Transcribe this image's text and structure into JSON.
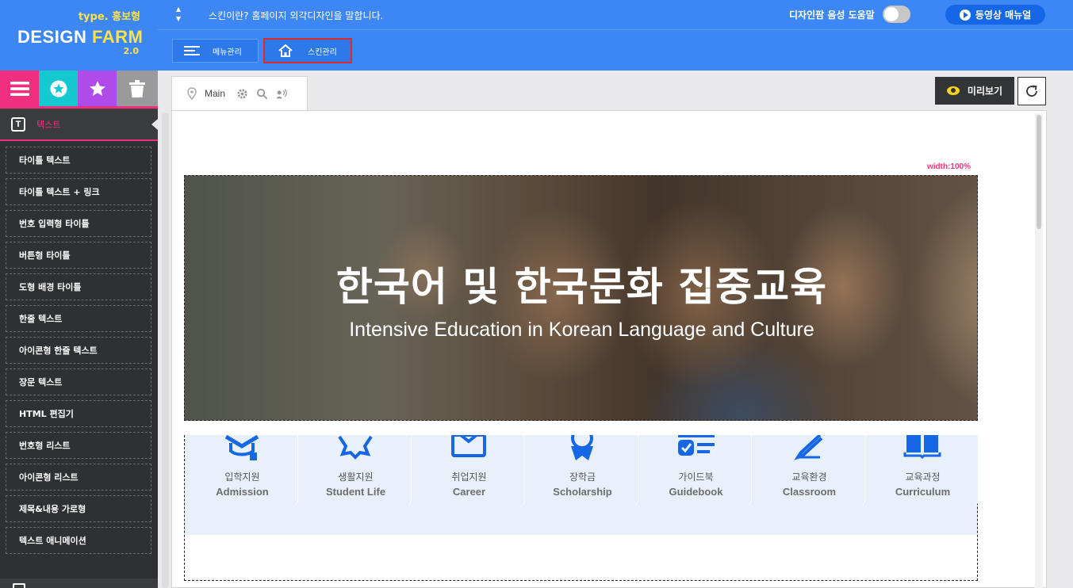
{
  "logo": {
    "type": "type. 홍보형",
    "design": "DESIGN",
    "farm": "FARM",
    "version": "2.0"
  },
  "topbar": {
    "description": "스킨이란? 홈페이지 외각디자인을 말합니다.",
    "voice_help_label": "디자인팜 음성 도움말",
    "voice_help_on": false,
    "video_manual_label": "동영상 매뉴얼"
  },
  "subbar": {
    "menu_label": "메뉴관리",
    "skin_label": "스킨관리"
  },
  "sidebar": {
    "category_icons": [
      "menu-icon",
      "star-circle-icon",
      "star-icon",
      "trash-icon"
    ],
    "category_colors": [
      "#f0307f",
      "#16c8d0",
      "#b04ae8",
      "#9a9a9c"
    ],
    "section_icon_letter": "T",
    "section_title": "텍스트",
    "items": [
      "타이틀 텍스트",
      "타이틀 텍스트 + 링크",
      "번호 입력형 타이틀",
      "버튼형 타이틀",
      "도형 배경 타이틀",
      "한줄 텍스트",
      "아이콘형 한줄 텍스트",
      "장문 텍스트",
      "HTML 편집기",
      "번호형 리스트",
      "아이콘형 리스트",
      "제목&내용 가로형",
      "텍스트 애니메이션"
    ]
  },
  "editor": {
    "tab_label": "Main",
    "preview_label": "미리보기",
    "width_label": "width:100%",
    "banner": {
      "title": "한국어 및 한국문화 집중교육",
      "subtitle": "Intensive Education in Korean Language and Culture"
    },
    "quick_links": [
      {
        "ko": "입학지원",
        "en": "Admission",
        "icon": "graduation-icon"
      },
      {
        "ko": "생활지원",
        "en": "Student Life",
        "icon": "badge-icon"
      },
      {
        "ko": "취업지원",
        "en": "Career",
        "icon": "briefcase-icon"
      },
      {
        "ko": "장학금",
        "en": "Scholarship",
        "icon": "medal-icon"
      },
      {
        "ko": "가이드북",
        "en": "Guidebook",
        "icon": "checklist-icon"
      },
      {
        "ko": "교육환경",
        "en": "Classroom",
        "icon": "pencil-icon"
      },
      {
        "ko": "교육과정",
        "en": "Curriculum",
        "icon": "book-icon"
      }
    ],
    "accent_color": "#1667e6"
  }
}
